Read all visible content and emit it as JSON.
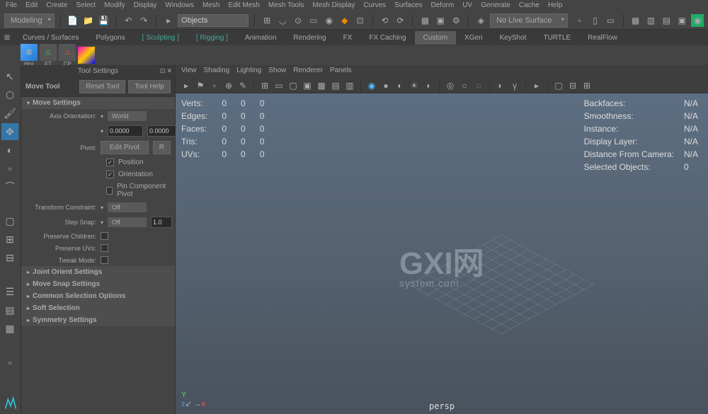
{
  "menubar": [
    "File",
    "Edit",
    "Create",
    "Select",
    "Modify",
    "Display",
    "Windows",
    "Mesh",
    "Edit Mesh",
    "Mesh Tools",
    "Mesh Display",
    "Curves",
    "Surfaces",
    "Deform",
    "UV",
    "Generate",
    "Cache",
    "Help"
  ],
  "toolbar1": {
    "workspace": "Modeling",
    "selectMode": "Objects",
    "liveSurface": "No Live Surface"
  },
  "tabs": [
    "Curves / Surfaces",
    "Polygons",
    "Sculpting",
    "Rigging",
    "Animation",
    "Rendering",
    "FX",
    "FX Caching",
    "Custom",
    "XGen",
    "KeyShot",
    "TURTLE",
    "RealFlow"
  ],
  "activeTab": "Custom",
  "shelfLabels": [
    "Hist",
    "FT",
    "CP",
    ""
  ],
  "toolSettings": {
    "panelTitle": "Tool Settings",
    "toolName": "Move Tool",
    "resetBtn": "Reset Tool",
    "helpBtn": "Tool Help",
    "sections": {
      "moveSettings": "Move Settings",
      "jointOrient": "Joint Orient Settings",
      "moveSnap": "Move Snap Settings",
      "commonSel": "Common Selection Options",
      "softSel": "Soft Selection",
      "symmetry": "Symmetry Settings"
    },
    "props": {
      "axisOrientLabel": "Axis Orientation:",
      "axisOrient": "World",
      "num1": "0.0000",
      "num2": "0.0000",
      "pivotLabel": "Pivot:",
      "pivotBtn": "Edit Pivot",
      "rBtn": "R",
      "position": "Position",
      "orientation": "Orientation",
      "pinComponent": "Pin Component Pivot",
      "transformConstraintLabel": "Transform Constraint:",
      "transformConstraint": "Off",
      "stepSnapLabel": "Step Snap:",
      "stepSnap": "Off",
      "stepSnapVal": "1.0",
      "preserveChildren": "Preserve Children:",
      "preserveUVs": "Preserve UVs:",
      "tweakMode": "Tweak Mode:"
    }
  },
  "viewport": {
    "menus": [
      "View",
      "Shading",
      "Lighting",
      "Show",
      "Renderer",
      "Panels"
    ],
    "stats": {
      "rows": [
        "Verts:",
        "Edges:",
        "Faces:",
        "Tris:",
        "UVs:"
      ],
      "cols": [
        "0",
        "0",
        "0"
      ]
    },
    "rightStats": [
      [
        "Backfaces:",
        "N/A"
      ],
      [
        "Smoothness:",
        "N/A"
      ],
      [
        "Instance:",
        "N/A"
      ],
      [
        "Display Layer:",
        "N/A"
      ],
      [
        "Distance From Camera:",
        "N/A"
      ],
      [
        "Selected Objects:",
        "0"
      ]
    ],
    "watermark": {
      "main": "GXI网",
      "sub": "system.com"
    },
    "camera": "persp",
    "axes": {
      "y": "Y",
      "x": "x",
      "z": "z"
    }
  }
}
